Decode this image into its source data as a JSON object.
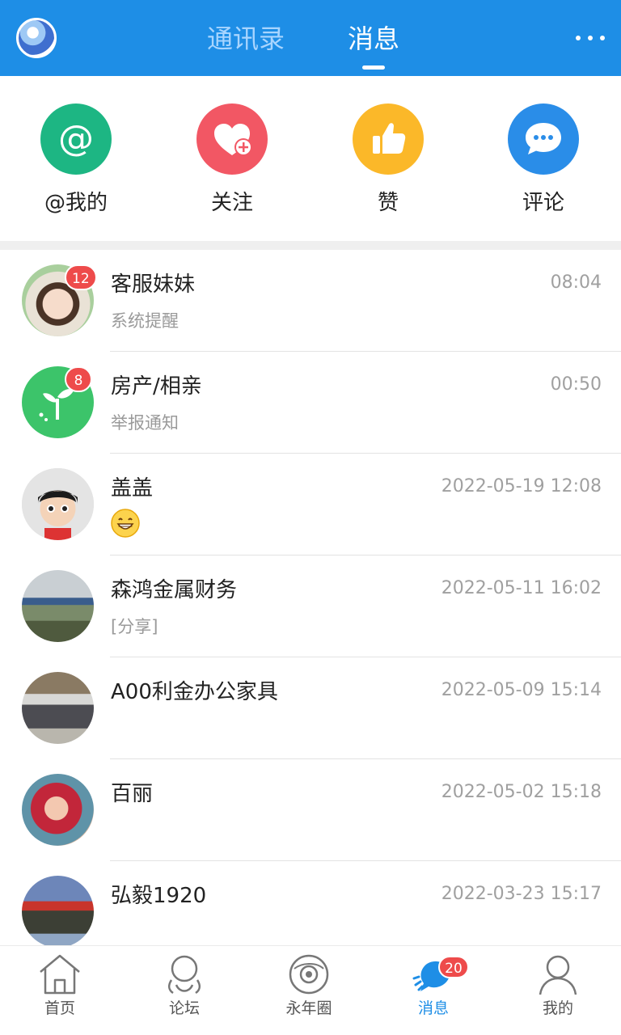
{
  "header": {
    "tabs": [
      {
        "label": "通讯录",
        "active": false
      },
      {
        "label": "消息",
        "active": true
      }
    ]
  },
  "quick_actions": [
    {
      "label": "@我的",
      "icon": "at-icon",
      "color": "#1db683"
    },
    {
      "label": "关注",
      "icon": "heart-plus-icon",
      "color": "#f25764"
    },
    {
      "label": "赞",
      "icon": "thumbs-up-icon",
      "color": "#fbb829"
    },
    {
      "label": "评论",
      "icon": "comment-bubble-icon",
      "color": "#2a8de8"
    }
  ],
  "messages": [
    {
      "name": "客服妹妹",
      "preview": "系统提醒",
      "time": "08:04",
      "badge": "12"
    },
    {
      "name": "房产/相亲",
      "preview": "举报通知",
      "time": "00:50",
      "badge": "8"
    },
    {
      "name": "盖盖",
      "preview_icon": "grinning-emoji-icon",
      "time": "2022-05-19 12:08"
    },
    {
      "name": "森鸿金属财务",
      "preview": "[分享]",
      "time": "2022-05-11 16:02"
    },
    {
      "name": "A00利金办公家具",
      "time": "2022-05-09 15:14"
    },
    {
      "name": "百丽",
      "time": "2022-05-02 15:18"
    },
    {
      "name": "弘毅1920",
      "time": "2022-03-23 15:17"
    }
  ],
  "bottom_nav": [
    {
      "label": "首页",
      "icon": "home-icon"
    },
    {
      "label": "论坛",
      "icon": "forum-icon"
    },
    {
      "label": "永年圈",
      "icon": "planet-icon"
    },
    {
      "label": "消息",
      "icon": "message-icon",
      "active": true,
      "badge": "20"
    },
    {
      "label": "我的",
      "icon": "person-icon"
    }
  ],
  "colors": {
    "accent": "#1e8ee6",
    "badge": "#ee4b4b"
  }
}
